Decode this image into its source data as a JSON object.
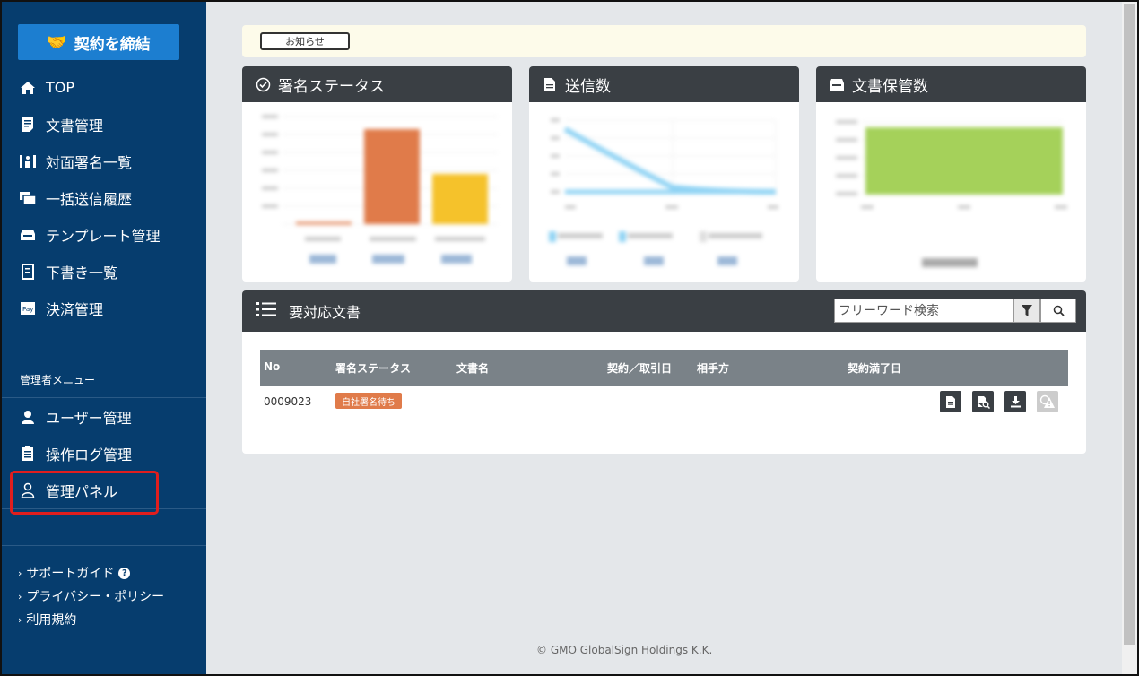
{
  "sidebar": {
    "contract_button": "契約を締結",
    "nav": [
      {
        "label": "TOP",
        "icon": "home-icon"
      },
      {
        "label": "文書管理",
        "icon": "document-list-icon"
      },
      {
        "label": "対面署名一覧",
        "icon": "face-to-face-icon"
      },
      {
        "label": "一括送信履歴",
        "icon": "bulk-send-icon"
      },
      {
        "label": "テンプレート管理",
        "icon": "template-icon"
      },
      {
        "label": "下書き一覧",
        "icon": "draft-icon"
      },
      {
        "label": "決済管理",
        "icon": "payment-icon"
      }
    ],
    "admin_label": "管理者メニュー",
    "admin_nav": [
      {
        "label": "ユーザー管理",
        "icon": "user-icon"
      },
      {
        "label": "操作ログ管理",
        "icon": "log-icon"
      },
      {
        "label": "管理パネル",
        "icon": "admin-panel-icon"
      }
    ],
    "footer": [
      "サポートガイド",
      "プライバシー・ポリシー",
      "利用規約"
    ]
  },
  "notice": {
    "label": "お知らせ"
  },
  "cards": {
    "signature_status": "署名ステータス",
    "sent_count": "送信数",
    "storage_count": "文書保管数"
  },
  "todo": {
    "title": "要対応文書",
    "search_placeholder": "フリーワード検索",
    "columns": [
      "No",
      "署名ステータス",
      "文書名",
      "契約／取引日",
      "相手方",
      "契約満了日"
    ],
    "rows": [
      {
        "no": "0009023",
        "status": "自社署名待ち",
        "doc_name": "",
        "date": "",
        "partner": "",
        "expiry": ""
      }
    ]
  },
  "copyright": "© GMO GlobalSign Holdings K.K.",
  "colors": {
    "sidebar": "#063d6e",
    "accent": "#1c7ed0",
    "bar_orange": "#e07b4a",
    "bar_yellow": "#f5c22b",
    "bar_green": "#a5d15a",
    "line_blue": "#8fd3f4"
  }
}
